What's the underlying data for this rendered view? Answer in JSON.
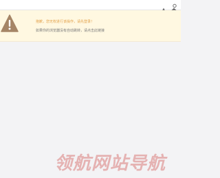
{
  "topbar": {
    "icons": [
      "warning-icon",
      "settings-icon"
    ]
  },
  "notice": {
    "icon": "warning-triangle-icon",
    "title": "抱歉，您无权进行该操作，请先登录！",
    "subtitle": "如果你的浏览器没有自动跳转，请点击此链接"
  },
  "watermark": {
    "text": "领航网站导航"
  },
  "colors": {
    "background": "#f3f3f5",
    "notice_background": "#fff8e1",
    "warning_icon": "#a58566",
    "title_text": "#e2a14a",
    "sub_text": "#7b7b7b",
    "watermark": "#e5b2b2"
  }
}
